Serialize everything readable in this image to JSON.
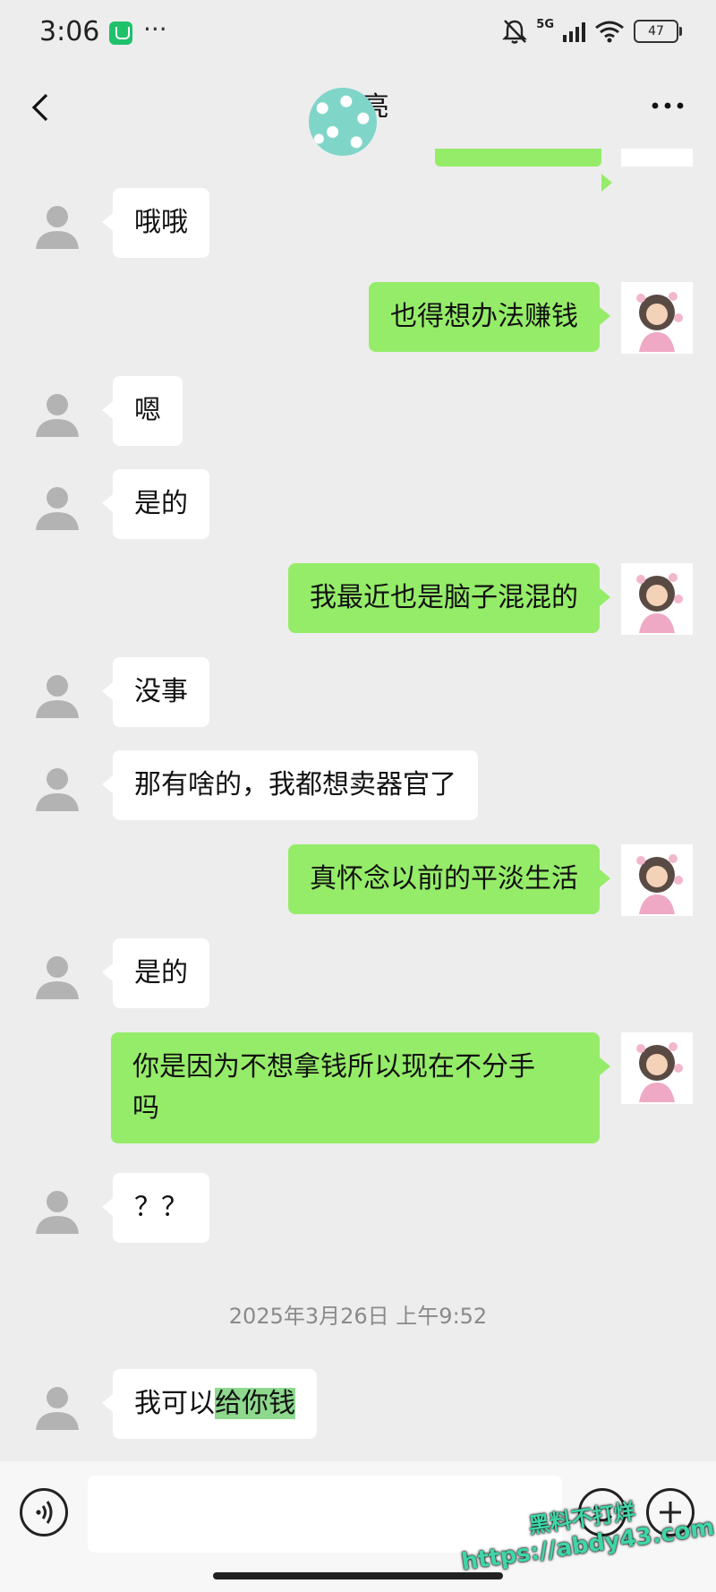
{
  "status_bar": {
    "time": "3:06",
    "dots": "···",
    "network": "5G",
    "battery": "47"
  },
  "header": {
    "contact_name": "杨  亮"
  },
  "messages": [
    {
      "side": "in",
      "text": "哦哦"
    },
    {
      "side": "out",
      "text": "也得想办法赚钱"
    },
    {
      "side": "in",
      "text": "嗯"
    },
    {
      "side": "in",
      "text": "是的"
    },
    {
      "side": "out",
      "text": "我最近也是脑子混混的"
    },
    {
      "side": "in",
      "text": "没事"
    },
    {
      "side": "in",
      "text": "那有啥的，我都想卖器官了"
    },
    {
      "side": "out",
      "text": "真怀念以前的平淡生活"
    },
    {
      "side": "in",
      "text": "是的"
    },
    {
      "side": "out",
      "text": "你是因为不想拿钱所以现在不分手\n吗"
    },
    {
      "side": "in",
      "text": "？？"
    },
    {
      "side": "in",
      "text_prefix": "我可以",
      "text_highlight": "给你钱"
    }
  ],
  "timestamp": "2025年3月26日 上午9:52",
  "watermark": {
    "line1": "黑料不打烊",
    "line2": "https://abdy43.com"
  },
  "colors": {
    "background": "#ededed",
    "bubble_in": "#ffffff",
    "bubble_out": "#95ec69"
  },
  "icons": [
    "back-arrow-icon",
    "more-dots-icon",
    "voice-icon",
    "emoji-icon",
    "plus-icon",
    "mute-bell-icon",
    "wifi-icon"
  ]
}
